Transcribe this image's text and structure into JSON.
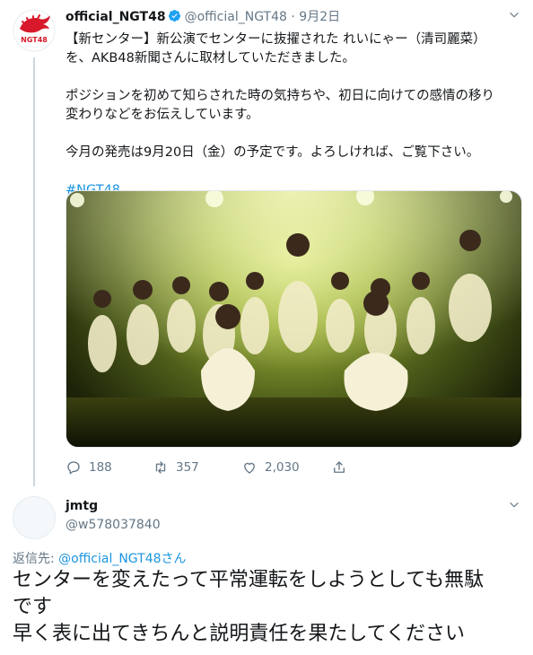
{
  "tweet": {
    "display_name": "official_NGT48",
    "handle": "@official_NGT48",
    "separator": "·",
    "date": "9月2日",
    "avatar_text": "NGT48",
    "body_lines": [
      "【新センター】新公演でセンターに抜擢された れいにゃー（清司麗菜）",
      "を、AKB48新聞さんに取材していただきました。",
      "ポジションを初めて知らされた時の気持ちや、初日に向けての感情の移り",
      "変わりなどをお伝えしています。",
      "今月の発売は9月20日（金）の予定です。よろしければ、ご覧下さい。"
    ],
    "hashtag": "#NGT48",
    "stats": {
      "replies": "188",
      "retweets": "357",
      "likes": "2,030"
    }
  },
  "reply": {
    "display_name": "jmtg",
    "handle": "@w578037840",
    "replying_prefix": "返信先: ",
    "replying_to": "@official_NGT48さん",
    "text_lines": [
      "センターを変えたって平常運転をしようとしても無駄",
      "です",
      "早く表に出てきちんと説明責任を果たしてください"
    ]
  },
  "icons": [
    "verified-icon",
    "caret-down-icon",
    "reply-icon",
    "retweet-icon",
    "like-icon",
    "share-icon"
  ],
  "colors": {
    "link": "#1b95e0",
    "muted": "#657786",
    "brand_red": "#d7192b",
    "verified": "#1da1f2"
  }
}
